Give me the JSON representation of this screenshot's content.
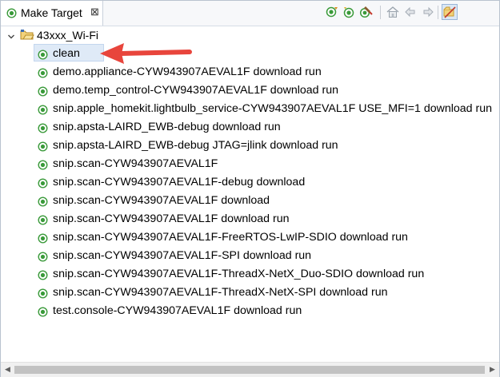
{
  "tab": {
    "title": "Make Target",
    "close": "⊠"
  },
  "toolbar": {
    "icons": [
      "build-target-icon",
      "new-target-icon",
      "edit-target-icon",
      "home-icon",
      "back-icon",
      "forward-icon",
      "hide-empty-folders-icon"
    ]
  },
  "tree": {
    "toggle": "⌄",
    "root": "43xxx_Wi-Fi",
    "items": [
      "clean",
      "demo.appliance-CYW943907AEVAL1F download run",
      "demo.temp_control-CYW943907AEVAL1F download run",
      "snip.apple_homekit.lightbulb_service-CYW943907AEVAL1F USE_MFI=1 download run",
      "snip.apsta-LAIRD_EWB-debug download run",
      "snip.apsta-LAIRD_EWB-debug JTAG=jlink download run",
      "snip.scan-CYW943907AEVAL1F",
      "snip.scan-CYW943907AEVAL1F-debug download",
      "snip.scan-CYW943907AEVAL1F download",
      "snip.scan-CYW943907AEVAL1F download run",
      "snip.scan-CYW943907AEVAL1F-FreeRTOS-LwIP-SDIO download run",
      "snip.scan-CYW943907AEVAL1F-SPI download run",
      "snip.scan-CYW943907AEVAL1F-ThreadX-NetX_Duo-SDIO download run",
      "snip.scan-CYW943907AEVAL1F-ThreadX-NetX-SPI download run",
      "test.console-CYW943907AEVAL1F download run"
    ],
    "selected_index": 0
  },
  "scrollbar": {
    "left_arrow": "◀",
    "right_arrow": "▶"
  },
  "colors": {
    "target_icon": "#3a9a3a",
    "selection": "#dfeaf7",
    "annotation_arrow": "#e8453c"
  }
}
